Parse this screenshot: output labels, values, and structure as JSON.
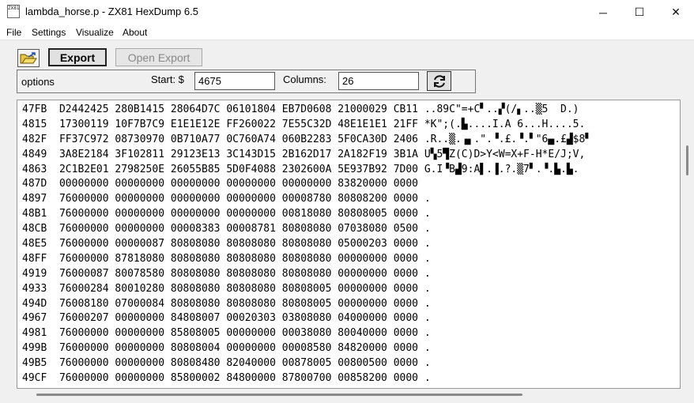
{
  "window": {
    "title": "lambda_horse.p - ZX81 HexDump 6.5",
    "icon_text": "ZX81",
    "minimize": "─",
    "maximize": "☐",
    "close": "✕"
  },
  "menu": {
    "items": [
      "File",
      "Settings",
      "Visualize",
      "About"
    ]
  },
  "toolbar": {
    "open_icon": "folder-open-icon",
    "export_label": "Export",
    "open_export_label": "Open Export"
  },
  "options": {
    "label": "options",
    "start_label": "Start: $",
    "start_value": "4675",
    "columns_label": "Columns:",
    "columns_value": "26",
    "refresh_icon": "refresh-icon"
  },
  "dump": {
    "rows": [
      {
        "addr": "47FB",
        "hex": [
          "D2442425",
          "280B1415",
          "28064D7C",
          "06101804",
          "EB7D0608",
          "21000029",
          "CB11"
        ],
        "text": "..89C\"=+C▘..▞(/▖..▒5  D.)"
      },
      {
        "addr": "4815",
        "hex": [
          "17300119",
          "10F7B7C9",
          "E1E1E12E",
          "FF260022",
          "7E55C32D",
          "48E1E1E1",
          "21FF"
        ],
        "text": "*K\";(.▙....I.A 6...H....5."
      },
      {
        "addr": "482F",
        "hex": [
          "FF37C972",
          "08730970",
          "0B710A77",
          "0C760A74",
          "060B2283",
          "5F0CA30D",
          "2406"
        ],
        "text": ".R..▒.▗▖.\".▝.£.▝.▘\"6▄.£▟$8▘"
      },
      {
        "addr": "4849",
        "hex": [
          "3A8E2184",
          "3F102811",
          "29123E13",
          "3C143D15",
          "2B162D17",
          "2A182F19",
          "3B1A"
        ],
        "text": "U▚5▜Z(C)D>Y<W=X+F-H*E/J;V,"
      },
      {
        "addr": "4863",
        "hex": [
          "2C1B2E01",
          "2798250E",
          "26055B85",
          "5D0F4088",
          "2302600A",
          "5E937B92",
          "7D00"
        ],
        "text": "G.I▝B▟9:A▌.▐.?.▒7▘.▝.▙.▙."
      },
      {
        "addr": "487D",
        "hex": [
          "00000000",
          "00000000",
          "00000000",
          "00000000",
          "00000000",
          "83820000",
          "0000"
        ],
        "text": ""
      },
      {
        "addr": "4897",
        "hex": [
          "76000000",
          "00000000",
          "00000000",
          "00000000",
          "00008780",
          "80808200",
          "0000"
        ],
        "text": "."
      },
      {
        "addr": "48B1",
        "hex": [
          "76000000",
          "00000000",
          "00000000",
          "00000000",
          "00818080",
          "80808005",
          "0000"
        ],
        "text": "."
      },
      {
        "addr": "48CB",
        "hex": [
          "76000000",
          "00000000",
          "00008383",
          "00008781",
          "80808080",
          "07038080",
          "0500"
        ],
        "text": "."
      },
      {
        "addr": "48E5",
        "hex": [
          "76000000",
          "00000087",
          "80808080",
          "80808080",
          "80808080",
          "05000203",
          "0000"
        ],
        "text": "."
      },
      {
        "addr": "48FF",
        "hex": [
          "76000000",
          "87818080",
          "80808080",
          "80808080",
          "80808080",
          "00000000",
          "0000"
        ],
        "text": "."
      },
      {
        "addr": "4919",
        "hex": [
          "76000087",
          "80078580",
          "80808080",
          "80808080",
          "80808080",
          "00000000",
          "0000"
        ],
        "text": "."
      },
      {
        "addr": "4933",
        "hex": [
          "76000284",
          "80010280",
          "80808080",
          "80808080",
          "80808005",
          "00000000",
          "0000"
        ],
        "text": "."
      },
      {
        "addr": "494D",
        "hex": [
          "76008180",
          "07000084",
          "80808080",
          "80808080",
          "80808005",
          "00000000",
          "0000"
        ],
        "text": "."
      },
      {
        "addr": "4967",
        "hex": [
          "76000207",
          "00000000",
          "84808007",
          "00020303",
          "03808080",
          "04000000",
          "0000"
        ],
        "text": "."
      },
      {
        "addr": "4981",
        "hex": [
          "76000000",
          "00000000",
          "85808005",
          "00000000",
          "00038080",
          "80040000",
          "0000"
        ],
        "text": "."
      },
      {
        "addr": "499B",
        "hex": [
          "76000000",
          "00000000",
          "80808004",
          "00000000",
          "00008580",
          "84820000",
          "0000"
        ],
        "text": "."
      },
      {
        "addr": "49B5",
        "hex": [
          "76000000",
          "00000000",
          "80808480",
          "82040000",
          "00878005",
          "00800500",
          "0000"
        ],
        "text": "."
      },
      {
        "addr": "49CF",
        "hex": [
          "76000000",
          "00000000",
          "85800002",
          "84800000",
          "87800700",
          "00858200",
          "0000"
        ],
        "text": "."
      }
    ]
  }
}
